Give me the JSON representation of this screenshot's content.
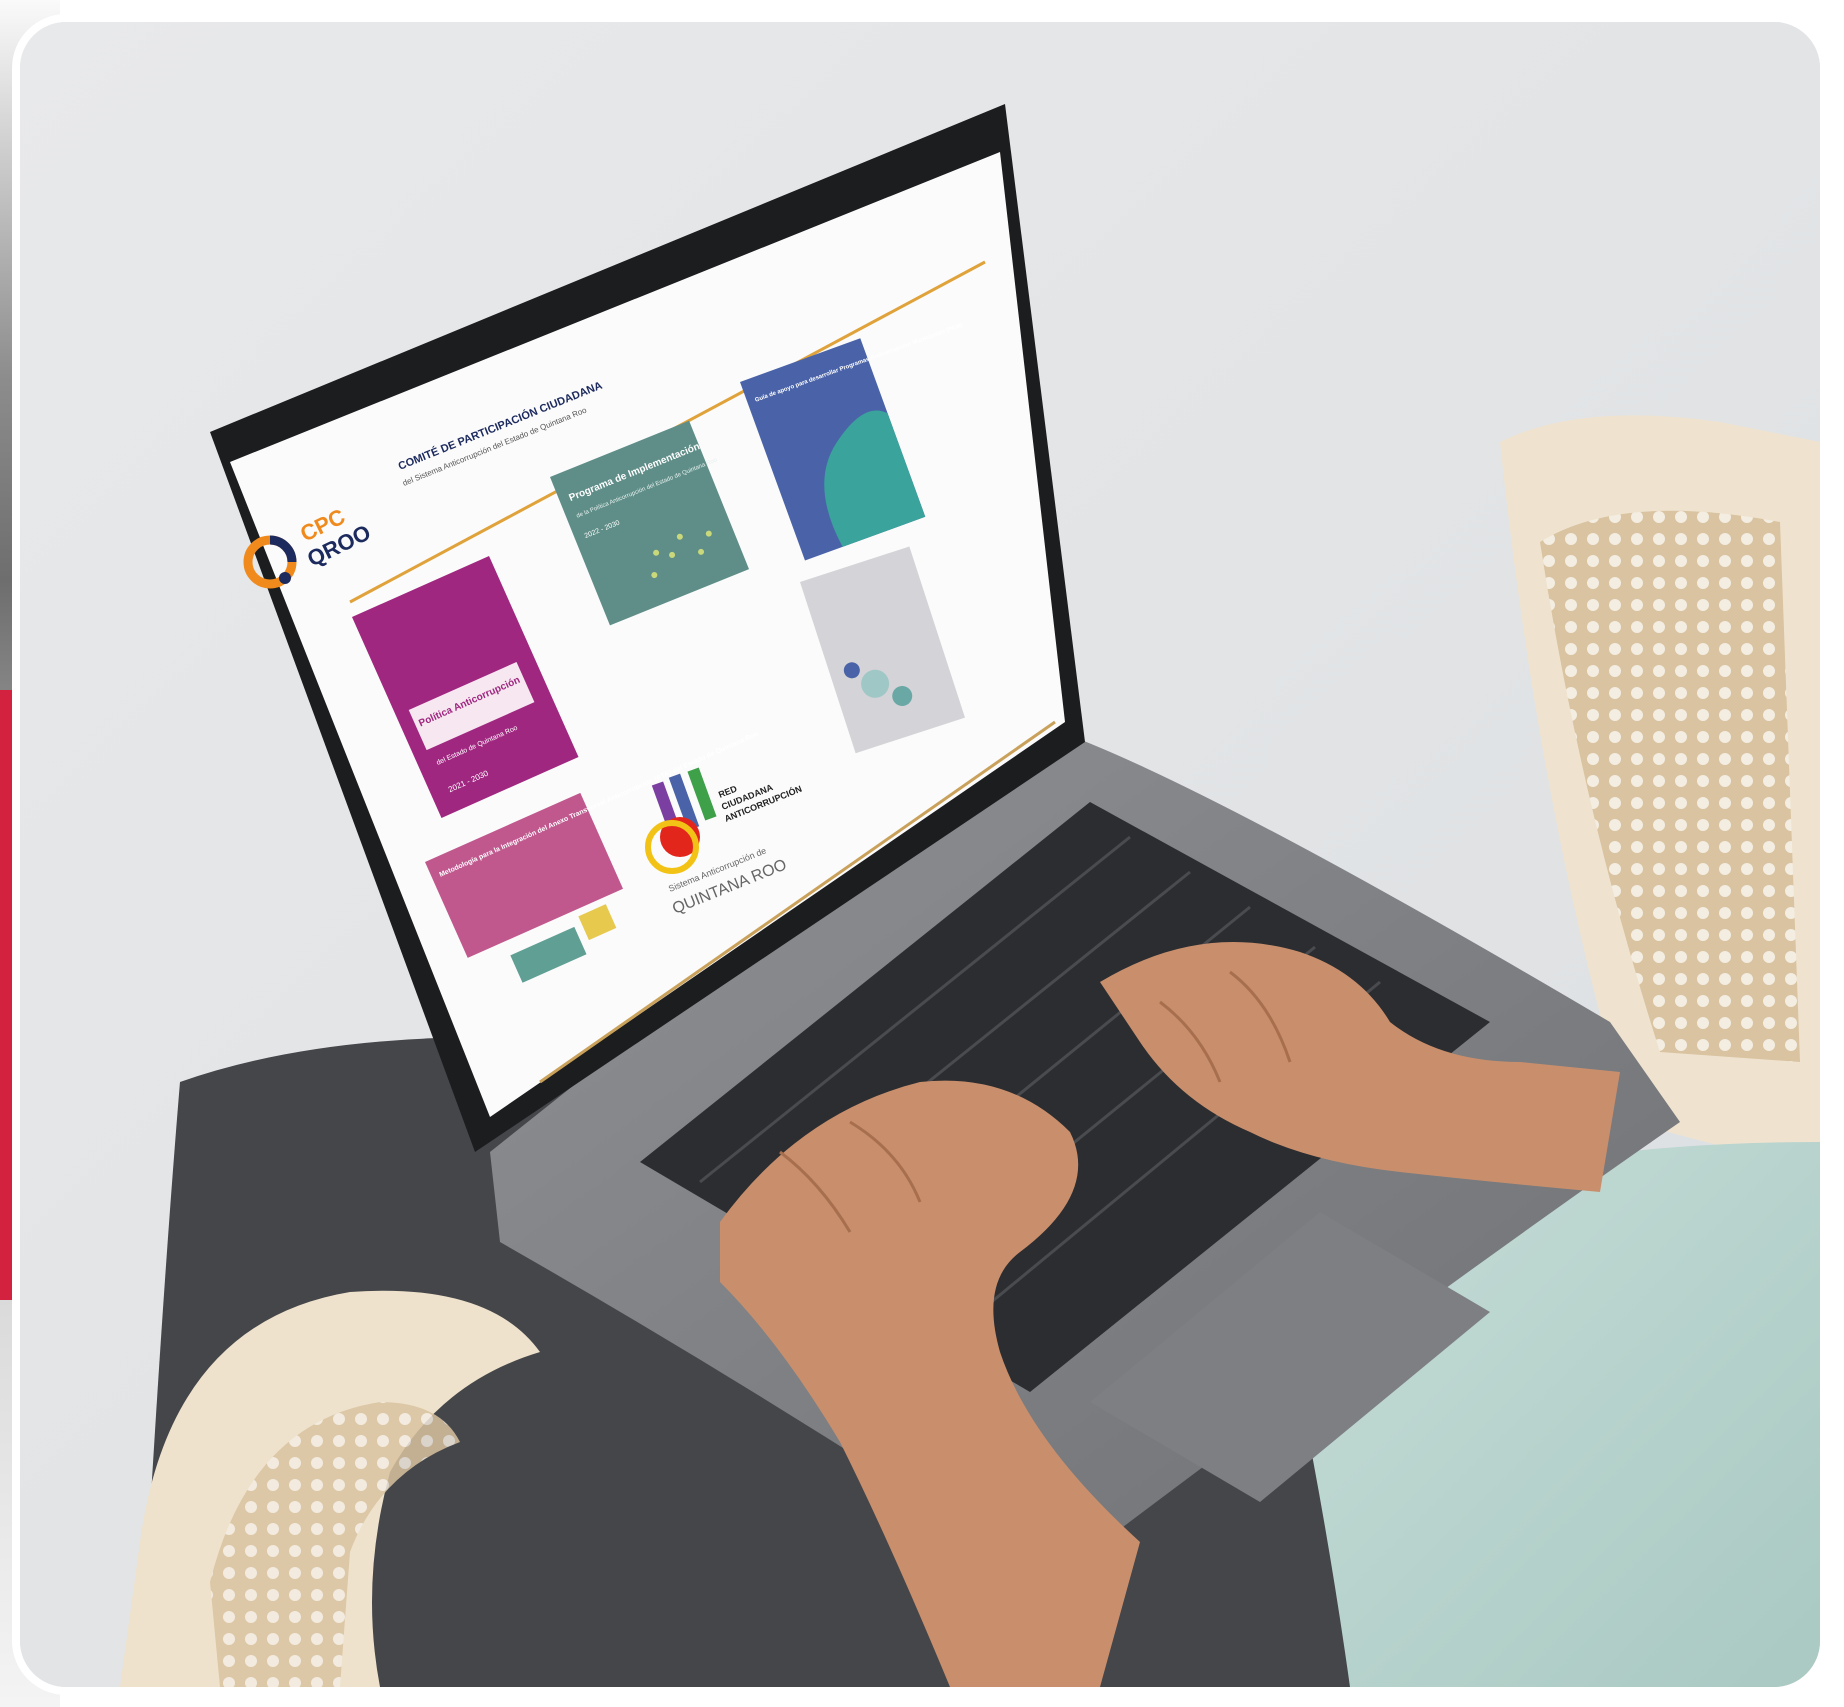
{
  "colors": {
    "accent_bar": "#d2223f",
    "backdrop": "#e3e5e7",
    "laptop_body": "#8a8c8f",
    "keyboard": "#2b2c2e",
    "skin": "#c98f6c",
    "sleeve": "#b9d5cf",
    "chair": "#e9dcc8",
    "pants": "#3f4043",
    "brand_orange": "#f08a1d",
    "brand_navy": "#1c2a5e",
    "magenta": "#a02780",
    "teal": "#5f8e88",
    "blue": "#4a63a8",
    "pink": "#c0588e"
  },
  "screen": {
    "logo_line1": "CPC",
    "logo_line2": "QROO",
    "header_title": "COMITÉ DE PARTICIPACIÓN CIUDADANA",
    "header_subtitle": "del Sistema Anticorrupción del Estado de Quintana Roo",
    "cards": {
      "politica": {
        "title": "Política Anticorrupción",
        "subtitle": "del Estado de Quintana Roo",
        "years": "2021 - 2030"
      },
      "programa": {
        "title": "Programa de Implementación",
        "subtitle": "de la Política Anticorrupción del Estado de Quintana Roo",
        "years": "2022 - 2030"
      },
      "guia": {
        "title": "Guía de apoyo para desarrollar Programas Anticorrupción Municipales (PAM)"
      },
      "metodologia": {
        "title": "Metodología para la Integración del Anexo Transversal Anticorrupción (ATA) del Estado de Quintana Roo"
      },
      "red": {
        "line1": "RED",
        "line2": "CIUDADANA",
        "line3": "ANTICORRUPCIÓN",
        "line4": "Sistema Anticorrupción de",
        "line5": "QUINTANA ROO"
      }
    }
  }
}
